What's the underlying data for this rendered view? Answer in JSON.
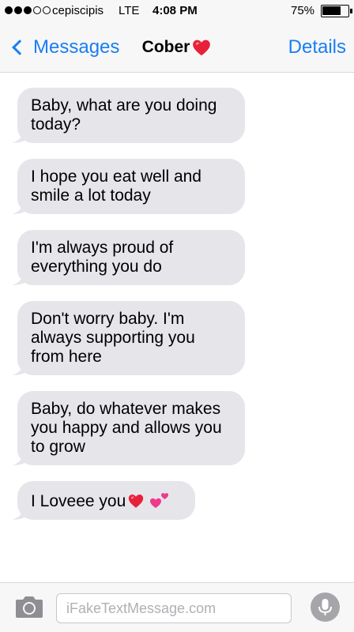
{
  "status_bar": {
    "carrier": "cepiscipis",
    "network": "LTE",
    "time": "4:08 PM",
    "battery_percent_label": "75%",
    "battery_level": 0.75,
    "signal_bars": 3,
    "signal_total": 5
  },
  "nav": {
    "back_label": "Messages",
    "contact_name": "Cober",
    "details_label": "Details"
  },
  "messages": [
    {
      "text": "Baby, what are you doing today?"
    },
    {
      "text": "I hope you eat well and smile a lot today"
    },
    {
      "text": "I'm always proud of everything you do"
    },
    {
      "text": "Don't worry baby. I'm always supporting you from here"
    },
    {
      "text": "Baby, do whatever makes you happy and allows you to grow"
    },
    {
      "text": "I Loveee you"
    }
  ],
  "input": {
    "placeholder": "iFakeTextMessage.com"
  },
  "colors": {
    "accent": "#1a7ef2",
    "bubble_incoming": "#e5e5ea",
    "heart": "#e8213a"
  },
  "icons": [
    "camera-icon",
    "microphone-icon",
    "chevron-left-icon",
    "red-heart-icon",
    "two-hearts-icon"
  ]
}
